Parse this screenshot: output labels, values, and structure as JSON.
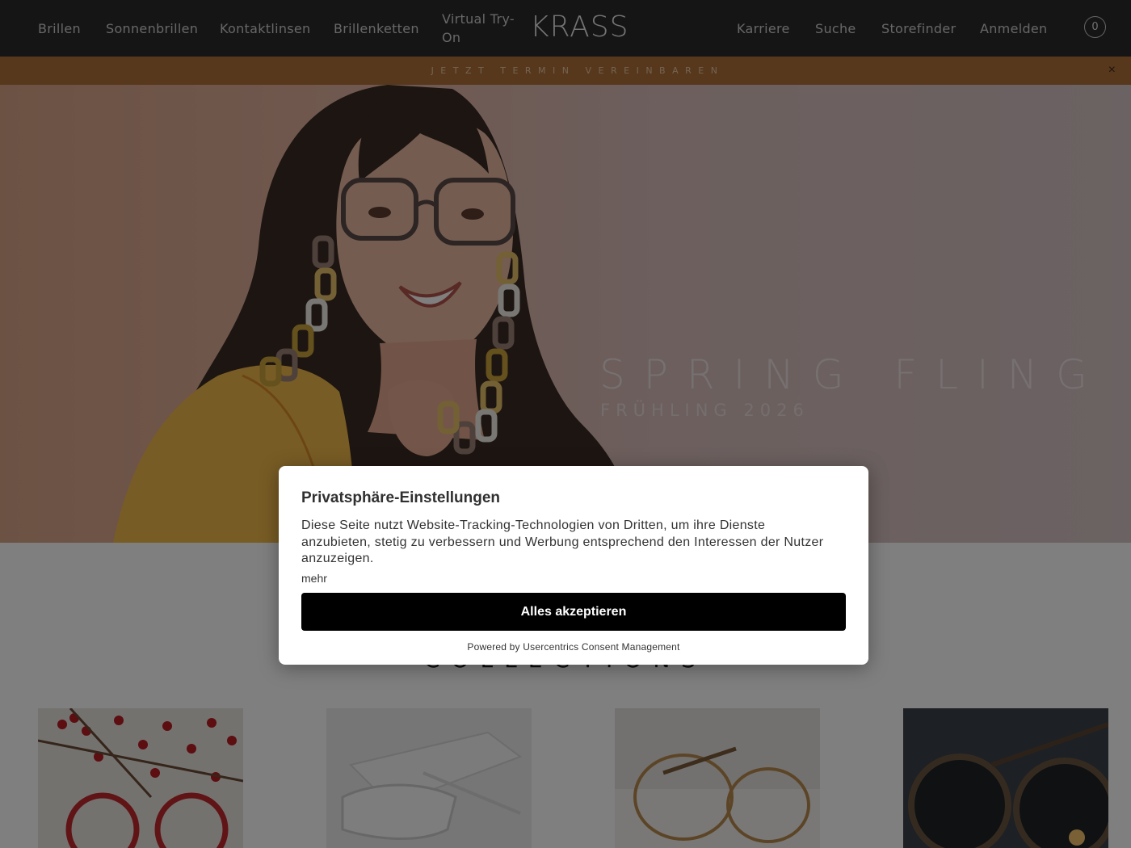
{
  "header": {
    "nav_left": [
      "Brillen",
      "Sonnenbrillen",
      "Kontaktlinsen",
      "Brillenketten"
    ],
    "virtual_tryon": "Virtual Try-On",
    "logo": "KRASS",
    "nav_right": [
      "Karriere",
      "Suche",
      "Storefinder",
      "Anmelden"
    ],
    "cart_count": "0"
  },
  "promo": {
    "text": "JETZT TERMIN VEREINBAREN",
    "close": "×"
  },
  "hero": {
    "title": "SPRING FLING",
    "subtitle": "FRÜHLING 2026"
  },
  "collections": {
    "title": "COLLECTIONS",
    "tiles": [
      "red-berries-glasses",
      "white-sunglasses",
      "gold-round-glasses",
      "dark-sunglasses"
    ]
  },
  "consent": {
    "title": "Privatsphäre-Einstellungen",
    "body": "Diese Seite nutzt Website-Tracking-Technologien von Dritten, um ihre Dienste anzubieten, stetig zu verbessern und Werbung entsprechend den Interessen der Nutzer anzuzeigen.",
    "more": "mehr",
    "accept": "Alles akzeptieren",
    "powered": "Powered by Usercentrics Consent Management"
  },
  "colors": {
    "header_bg": "#2a2a2a",
    "promo_bg": "#b0713a",
    "button_bg": "#000000",
    "overlay": "rgba(0,0,0,0.5)"
  }
}
